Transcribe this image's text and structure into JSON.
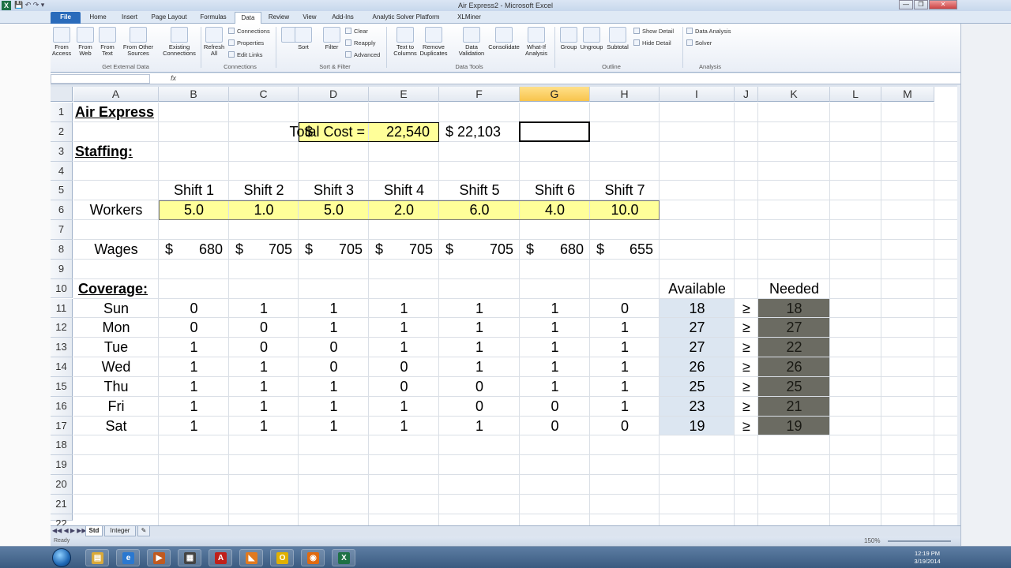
{
  "window": {
    "title": "Air Express2 - Microsoft Excel",
    "app_icon": "X"
  },
  "tabs": [
    "File",
    "Home",
    "Insert",
    "Page Layout",
    "Formulas",
    "Data",
    "Review",
    "View",
    "Add-Ins",
    "Analytic Solver Platform",
    "XLMiner"
  ],
  "active_tab": "Data",
  "ribbon": {
    "get_external": {
      "items": [
        [
          "From",
          "Access"
        ],
        [
          "From",
          "Web"
        ],
        [
          "From",
          "Text"
        ],
        [
          "From Other",
          "Sources"
        ],
        [
          "Existing",
          "Connections"
        ]
      ],
      "label": "Get External Data"
    },
    "connections": {
      "refresh": [
        "Refresh",
        "All"
      ],
      "small": [
        "Connections",
        "Properties",
        "Edit Links"
      ],
      "label": "Connections"
    },
    "sort_filter": {
      "sort": "Sort",
      "filter": "Filter",
      "small": [
        "Clear",
        "Reapply",
        "Advanced"
      ],
      "label": "Sort & Filter"
    },
    "data_tools": {
      "items": [
        [
          "Text to",
          "Columns"
        ],
        [
          "Remove",
          "Duplicates"
        ],
        [
          "Data",
          "Validation"
        ],
        [
          "Consolidate",
          ""
        ],
        [
          "What-If",
          "Analysis"
        ]
      ],
      "label": "Data Tools"
    },
    "outline": {
      "items": [
        "Group",
        "Ungroup",
        "Subtotal"
      ],
      "small": [
        "Show Detail",
        "Hide Detail"
      ],
      "label": "Outline"
    },
    "analysis": {
      "small": [
        "Data Analysis",
        "Solver"
      ],
      "label": "Analysis"
    }
  },
  "formula_bar": {
    "fx": "fx",
    "content": ""
  },
  "columns": [
    "A",
    "B",
    "C",
    "D",
    "E",
    "F",
    "G",
    "H",
    "I",
    "J",
    "K",
    "L",
    "M"
  ],
  "selected_column": "G",
  "rows": [
    "1",
    "2",
    "3",
    "4",
    "5",
    "6",
    "7",
    "8",
    "9",
    "10",
    "11",
    "12",
    "13",
    "14",
    "15",
    "16",
    "17",
    "18",
    "19",
    "20",
    "21",
    "22"
  ],
  "sheet": {
    "title": "Air Express",
    "staffing": "Staffing:",
    "coverage": "Coverage:",
    "total_cost_label": "Total Cost =",
    "total_cost_currency": "$",
    "total_cost_value": "22,540",
    "f2_value": "$  22,103",
    "shift_headers": [
      "Shift 1",
      "Shift 2",
      "Shift 3",
      "Shift 4",
      "Shift 5",
      "Shift 6",
      "Shift 7"
    ],
    "workers_label": "Workers",
    "workers": [
      "5.0",
      "1.0",
      "5.0",
      "2.0",
      "6.0",
      "4.0",
      "10.0"
    ],
    "wages_label": "Wages",
    "wage_currency": "$",
    "wages": [
      "680",
      "705",
      "705",
      "705",
      "705",
      "680",
      "655"
    ],
    "available_label": "Available",
    "needed_label": "Needed",
    "geq": "≥",
    "days": [
      "Sun",
      "Mon",
      "Tue",
      "Wed",
      "Thu",
      "Fri",
      "Sat"
    ],
    "coverage_matrix": [
      [
        "0",
        "1",
        "1",
        "1",
        "1",
        "1",
        "0"
      ],
      [
        "0",
        "0",
        "1",
        "1",
        "1",
        "1",
        "1"
      ],
      [
        "1",
        "0",
        "0",
        "1",
        "1",
        "1",
        "1"
      ],
      [
        "1",
        "1",
        "0",
        "0",
        "1",
        "1",
        "1"
      ],
      [
        "1",
        "1",
        "1",
        "0",
        "0",
        "1",
        "1"
      ],
      [
        "1",
        "1",
        "1",
        "1",
        "0",
        "0",
        "1"
      ],
      [
        "1",
        "1",
        "1",
        "1",
        "1",
        "0",
        "0"
      ]
    ],
    "available": [
      "18",
      "27",
      "27",
      "26",
      "25",
      "23",
      "19"
    ],
    "needed": [
      "18",
      "27",
      "22",
      "26",
      "25",
      "21",
      "19"
    ]
  },
  "sheet_tabs": [
    "Std",
    "Integer"
  ],
  "active_sheet": "Std",
  "status": {
    "ready": "Ready",
    "zoom": "150%"
  },
  "clock": {
    "time": "12:19 PM",
    "date": "3/19/2014"
  },
  "colors": {
    "input_fill": "#ffff99",
    "available_fill": "#dce6f1",
    "needed_fill": "#6b6b62",
    "selection": "#f8c44c"
  },
  "taskbar_apps": [
    "explorer-icon",
    "ie-icon",
    "media-player-icon",
    "windows-icon",
    "acrobat-icon",
    "matlab-icon",
    "outlook-icon",
    "firefox-icon",
    "excel-icon"
  ]
}
